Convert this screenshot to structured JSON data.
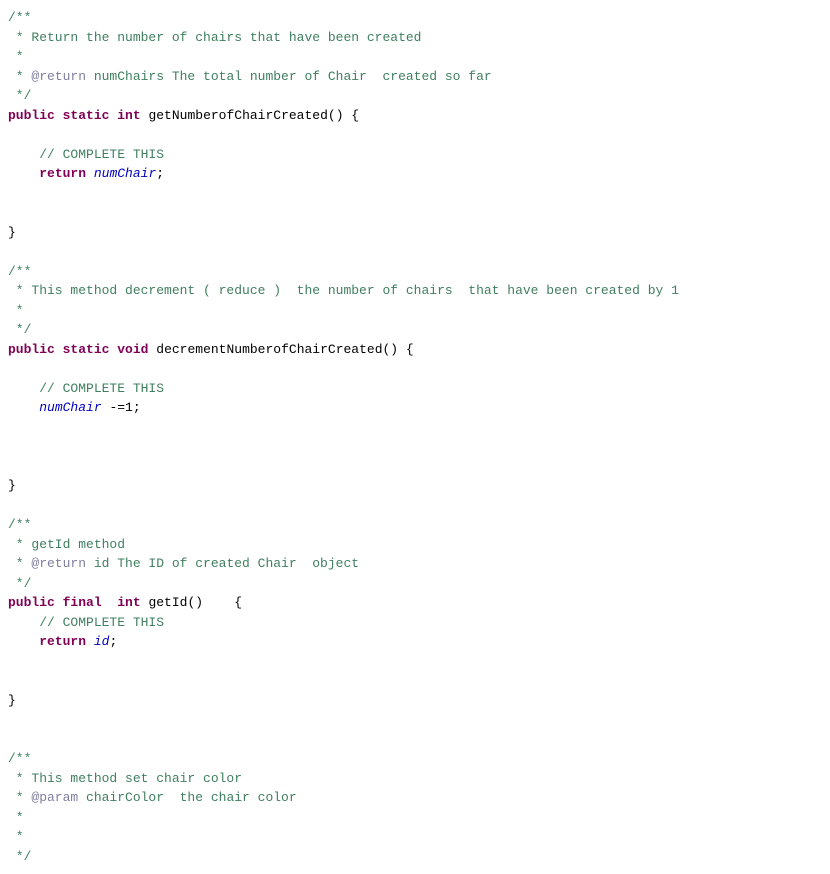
{
  "code": {
    "lines": [
      {
        "tokens": [
          {
            "text": "/**",
            "class": "comment"
          }
        ]
      },
      {
        "tokens": [
          {
            "text": " * Return the number of chairs that have been created",
            "class": "comment"
          }
        ]
      },
      {
        "tokens": [
          {
            "text": " *",
            "class": "comment"
          }
        ]
      },
      {
        "tokens": [
          {
            "text": " * ",
            "class": "comment"
          },
          {
            "text": "@return",
            "class": "comment-tag"
          },
          {
            "text": " numChairs The total number of Chair  created so far",
            "class": "comment"
          }
        ]
      },
      {
        "tokens": [
          {
            "text": " */",
            "class": "comment"
          }
        ]
      },
      {
        "tokens": [
          {
            "text": "public",
            "class": "keyword"
          },
          {
            "text": " ",
            "class": "plain"
          },
          {
            "text": "static",
            "class": "keyword"
          },
          {
            "text": " ",
            "class": "plain"
          },
          {
            "text": "int",
            "class": "keyword"
          },
          {
            "text": " getNumberofChairCreated() {",
            "class": "plain"
          }
        ]
      },
      {
        "tokens": [
          {
            "text": "",
            "class": "plain"
          }
        ]
      },
      {
        "tokens": [
          {
            "text": "    ",
            "class": "plain"
          },
          {
            "text": "// COMPLETE THIS",
            "class": "inline-comment"
          }
        ]
      },
      {
        "tokens": [
          {
            "text": "    ",
            "class": "plain"
          },
          {
            "text": "return",
            "class": "keyword"
          },
          {
            "text": " ",
            "class": "plain"
          },
          {
            "text": "numChair",
            "class": "variable"
          },
          {
            "text": ";",
            "class": "plain"
          }
        ]
      },
      {
        "tokens": [
          {
            "text": "",
            "class": "plain"
          }
        ]
      },
      {
        "tokens": [
          {
            "text": "",
            "class": "plain"
          }
        ]
      },
      {
        "tokens": [
          {
            "text": "}",
            "class": "plain"
          }
        ]
      },
      {
        "tokens": [
          {
            "text": "",
            "class": "plain"
          }
        ]
      },
      {
        "tokens": [
          {
            "text": "/**",
            "class": "comment"
          }
        ]
      },
      {
        "tokens": [
          {
            "text": " * This method decrement ( reduce )  the number of chairs  that have been created by 1",
            "class": "comment"
          }
        ]
      },
      {
        "tokens": [
          {
            "text": " *",
            "class": "comment"
          }
        ]
      },
      {
        "tokens": [
          {
            "text": " */",
            "class": "comment"
          }
        ]
      },
      {
        "tokens": [
          {
            "text": "public",
            "class": "keyword"
          },
          {
            "text": " ",
            "class": "plain"
          },
          {
            "text": "static",
            "class": "keyword"
          },
          {
            "text": " ",
            "class": "plain"
          },
          {
            "text": "void",
            "class": "keyword"
          },
          {
            "text": " decrementNumberofChairCreated() {",
            "class": "plain"
          }
        ]
      },
      {
        "tokens": [
          {
            "text": "",
            "class": "plain"
          }
        ]
      },
      {
        "tokens": [
          {
            "text": "    ",
            "class": "plain"
          },
          {
            "text": "// COMPLETE THIS",
            "class": "inline-comment"
          }
        ]
      },
      {
        "tokens": [
          {
            "text": "    ",
            "class": "plain"
          },
          {
            "text": "numChair",
            "class": "variable"
          },
          {
            "text": " -=1;",
            "class": "plain"
          }
        ]
      },
      {
        "tokens": [
          {
            "text": "",
            "class": "plain"
          }
        ]
      },
      {
        "tokens": [
          {
            "text": "",
            "class": "plain"
          }
        ]
      },
      {
        "tokens": [
          {
            "text": "",
            "class": "plain"
          }
        ]
      },
      {
        "tokens": [
          {
            "text": "}",
            "class": "plain"
          }
        ]
      },
      {
        "tokens": [
          {
            "text": "",
            "class": "plain"
          }
        ]
      },
      {
        "tokens": [
          {
            "text": "/**",
            "class": "comment"
          }
        ]
      },
      {
        "tokens": [
          {
            "text": " * getId method",
            "class": "comment"
          }
        ]
      },
      {
        "tokens": [
          {
            "text": " * ",
            "class": "comment"
          },
          {
            "text": "@return",
            "class": "comment-tag"
          },
          {
            "text": " id The ID of created Chair  object",
            "class": "comment"
          }
        ]
      },
      {
        "tokens": [
          {
            "text": " */",
            "class": "comment"
          }
        ]
      },
      {
        "tokens": [
          {
            "text": "public",
            "class": "keyword"
          },
          {
            "text": " ",
            "class": "plain"
          },
          {
            "text": "final",
            "class": "keyword"
          },
          {
            "text": "  ",
            "class": "plain"
          },
          {
            "text": "int",
            "class": "keyword"
          },
          {
            "text": " getId()    {",
            "class": "plain"
          }
        ]
      },
      {
        "tokens": [
          {
            "text": "    ",
            "class": "plain"
          },
          {
            "text": "// COMPLETE THIS",
            "class": "inline-comment"
          }
        ]
      },
      {
        "tokens": [
          {
            "text": "    ",
            "class": "plain"
          },
          {
            "text": "return",
            "class": "keyword"
          },
          {
            "text": " ",
            "class": "plain"
          },
          {
            "text": "id",
            "class": "variable"
          },
          {
            "text": ";",
            "class": "plain"
          }
        ]
      },
      {
        "tokens": [
          {
            "text": "",
            "class": "plain"
          }
        ]
      },
      {
        "tokens": [
          {
            "text": "",
            "class": "plain"
          }
        ]
      },
      {
        "tokens": [
          {
            "text": "}",
            "class": "plain"
          }
        ]
      },
      {
        "tokens": [
          {
            "text": "",
            "class": "plain"
          }
        ]
      },
      {
        "tokens": [
          {
            "text": "",
            "class": "plain"
          }
        ]
      },
      {
        "tokens": [
          {
            "text": "/**",
            "class": "comment"
          }
        ]
      },
      {
        "tokens": [
          {
            "text": " * This method set chair color",
            "class": "comment"
          }
        ]
      },
      {
        "tokens": [
          {
            "text": " * ",
            "class": "comment"
          },
          {
            "text": "@param",
            "class": "comment-tag"
          },
          {
            "text": " chairColor  the chair color",
            "class": "comment"
          }
        ]
      },
      {
        "tokens": [
          {
            "text": " *",
            "class": "comment"
          }
        ]
      },
      {
        "tokens": [
          {
            "text": " *",
            "class": "comment"
          }
        ]
      },
      {
        "tokens": [
          {
            "text": " */",
            "class": "comment"
          }
        ]
      }
    ]
  }
}
